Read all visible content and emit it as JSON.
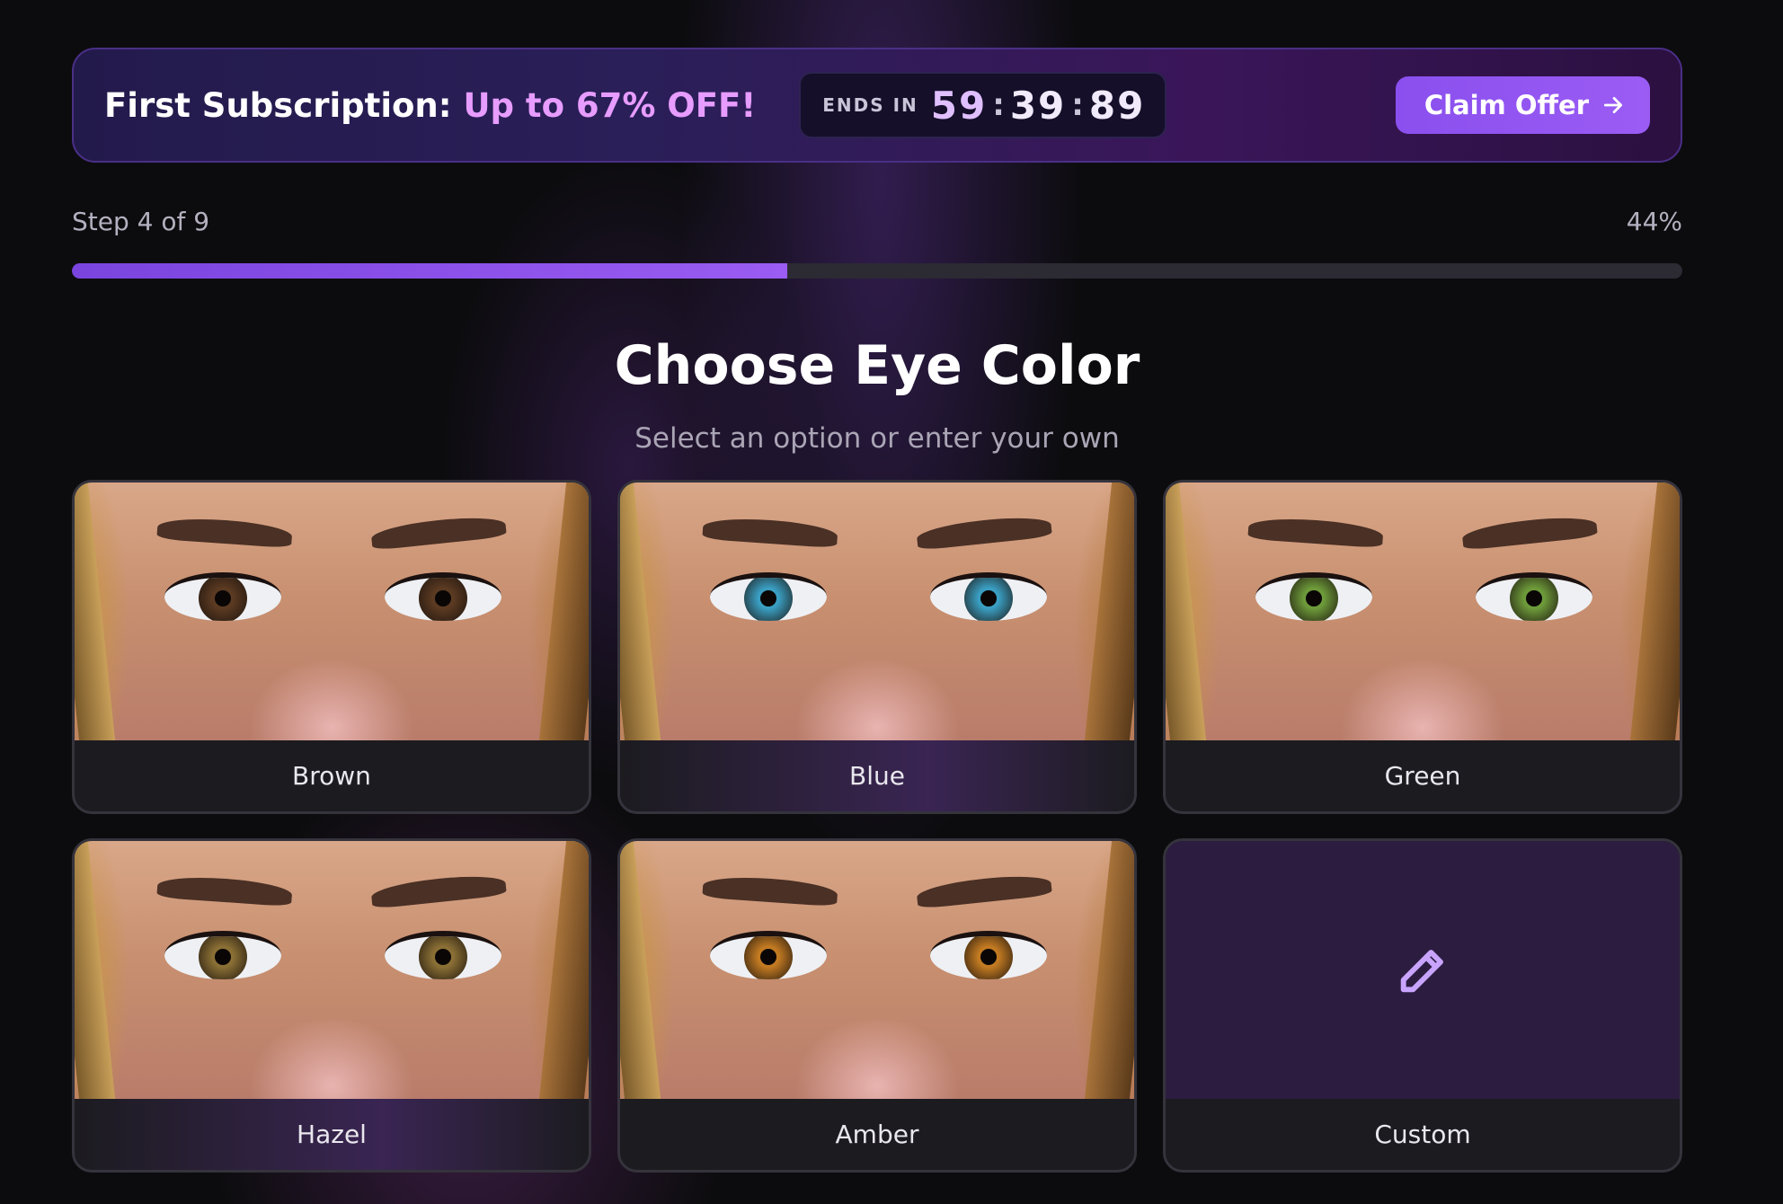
{
  "promo": {
    "title": "First Subscription:",
    "highlight": "Up to 67% OFF!",
    "timer_label": "ENDS IN",
    "timer_minutes": "59",
    "timer_seconds": "39",
    "timer_centis": "89",
    "claim_label": "Claim Offer"
  },
  "progress": {
    "step_text": "Step 4 of 9",
    "percent_text": "44%",
    "fraction": 0.444
  },
  "header": {
    "title": "Choose Eye Color",
    "subtitle": "Select an option or enter your own"
  },
  "options": [
    {
      "label": "Brown",
      "iris_color": "#5b3a22"
    },
    {
      "label": "Blue",
      "iris_color": "#3a9ec2"
    },
    {
      "label": "Green",
      "iris_color": "#6d9a3a"
    },
    {
      "label": "Hazel",
      "iris_color": "#8a6f35"
    },
    {
      "label": "Amber",
      "iris_color": "#c27a22"
    },
    {
      "label": "Custom",
      "icon": "pencil-icon"
    }
  ],
  "colors": {
    "accent": "#9b5cf4",
    "highlight_pink": "#e79cff",
    "pencil": "#c9a4ff"
  }
}
